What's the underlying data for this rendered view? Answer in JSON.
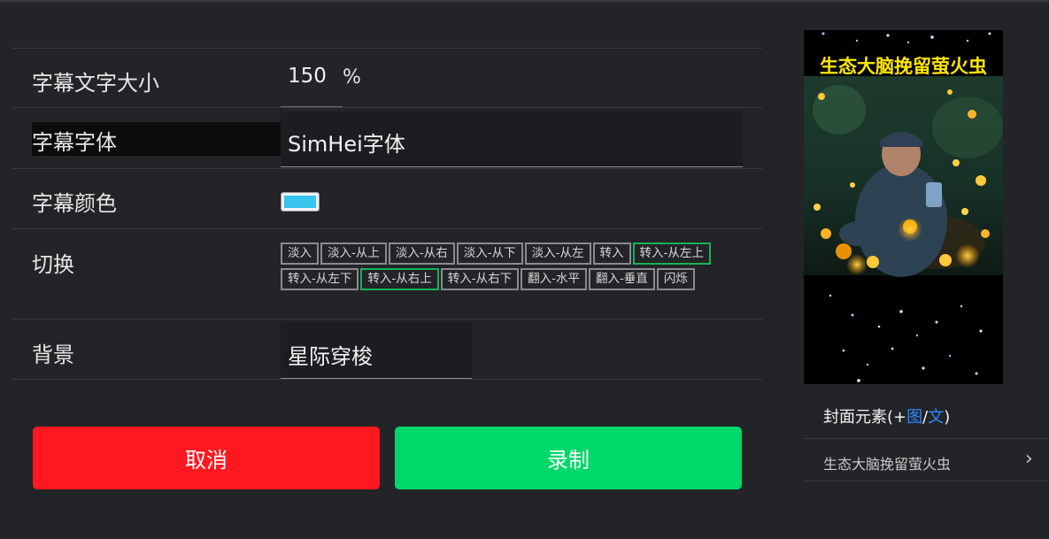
{
  "settings": {
    "font_size": {
      "label": "字幕文字大小",
      "value": "150",
      "unit": "%"
    },
    "font_family": {
      "label": "字幕字体",
      "value": "SimHei字体"
    },
    "font_color": {
      "label": "字幕颜色",
      "color": "#37c4ef"
    },
    "transition": {
      "label": "切换",
      "options": [
        {
          "label": "淡入",
          "active": false
        },
        {
          "label": "淡入-从上",
          "active": false
        },
        {
          "label": "淡入-从右",
          "active": false
        },
        {
          "label": "淡入-从下",
          "active": false
        },
        {
          "label": "淡入-从左",
          "active": false
        },
        {
          "label": "转入",
          "active": false
        },
        {
          "label": "转入-从左上",
          "active": true
        },
        {
          "label": "转入-从左下",
          "active": false
        },
        {
          "label": "转入-从右上",
          "active": true
        },
        {
          "label": "转入-从右下",
          "active": false
        },
        {
          "label": "翻入-水平",
          "active": false
        },
        {
          "label": "翻入-垂直",
          "active": false
        },
        {
          "label": "闪烁",
          "active": false
        }
      ]
    },
    "background": {
      "label": "背景",
      "value": "星际穿梭"
    }
  },
  "actions": {
    "cancel_label": "取消",
    "record_label": "录制"
  },
  "preview": {
    "title": "生态大脑挽留萤火虫"
  },
  "cover": {
    "heading_prefix": "封面元素(+",
    "image_link": "图",
    "separator": "/",
    "text_link": "文",
    "heading_suffix": ")",
    "item_text": "生态大脑挽留萤火虫"
  },
  "colors": {
    "accent_green": "#00d86a",
    "accent_red": "#ff1820",
    "active_chip_border": "#19b25a",
    "link_blue": "#2b8cff"
  }
}
